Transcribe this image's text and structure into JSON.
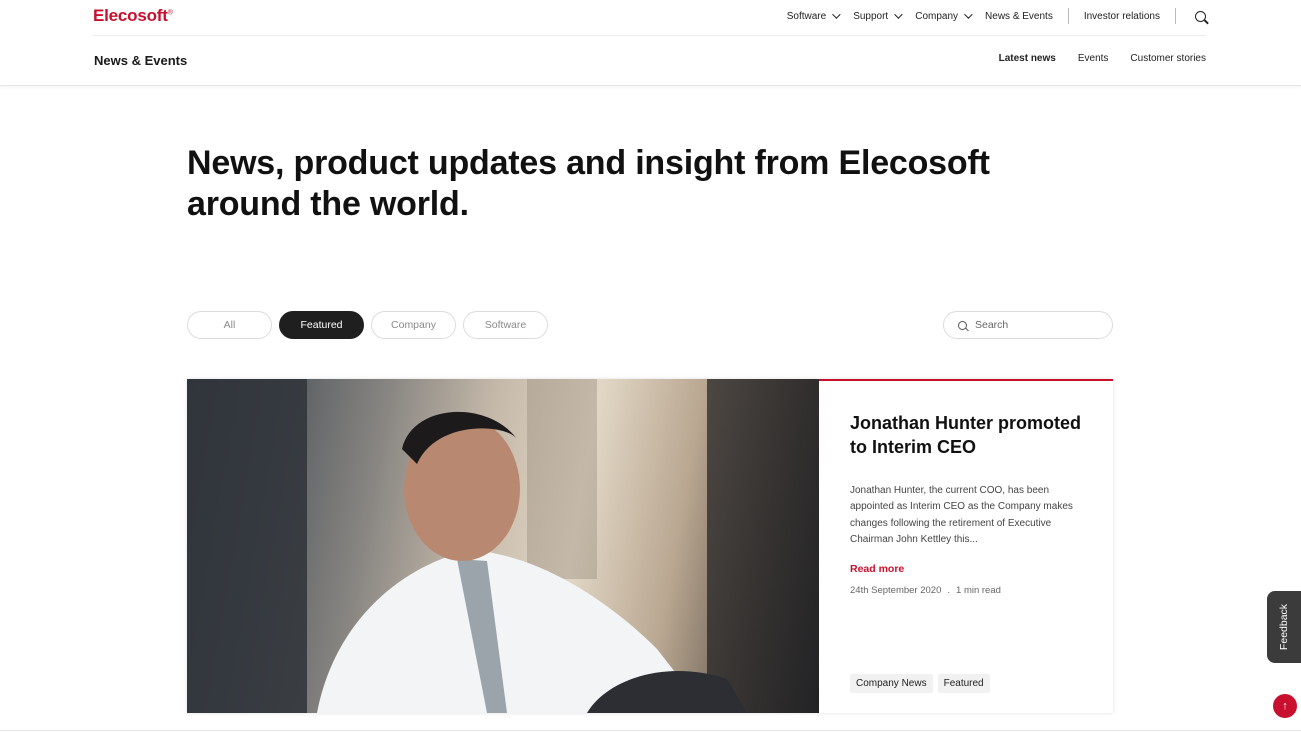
{
  "brand": {
    "logo_text": "Elecosoft",
    "logo_mark": "®",
    "accent_color": "#c8102e"
  },
  "topnav": {
    "items": [
      {
        "label": "Software",
        "has_dropdown": true
      },
      {
        "label": "Support",
        "has_dropdown": true
      },
      {
        "label": "Company",
        "has_dropdown": true
      },
      {
        "label": "News & Events",
        "has_dropdown": false
      },
      {
        "label": "Investor relations",
        "has_dropdown": false
      }
    ],
    "search_icon": "search-icon"
  },
  "section": {
    "title": "News & Events",
    "subnav": [
      {
        "label": "Latest news",
        "active": true
      },
      {
        "label": "Events",
        "active": false
      },
      {
        "label": "Customer stories",
        "active": false
      }
    ]
  },
  "hero": {
    "heading": "News, product updates and insight from Elecosoft around the world."
  },
  "filters": {
    "pills": [
      {
        "label": "All",
        "active": false
      },
      {
        "label": "Featured",
        "active": true
      },
      {
        "label": "Company",
        "active": false
      },
      {
        "label": "Software",
        "active": false
      }
    ],
    "search_placeholder": "Search"
  },
  "featured_article": {
    "title": "Jonathan Hunter promoted to Interim CEO",
    "excerpt": "Jonathan Hunter, the current COO, has been appointed as Interim CEO as the Company makes changes following the retirement of Executive Chairman John Kettley this...",
    "read_more": "Read more",
    "date": "24th September 2020",
    "separator": ".",
    "read_time": "1 min read",
    "tags": [
      "Company News",
      "Featured"
    ]
  },
  "widgets": {
    "feedback_label": "Feedback",
    "back_to_top_icon": "↑"
  }
}
